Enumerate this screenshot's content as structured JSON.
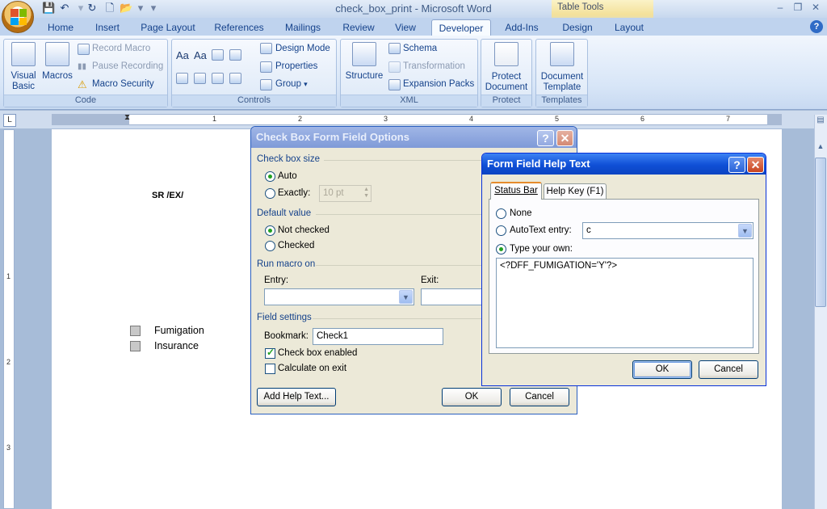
{
  "window": {
    "title": "check_box_print - Microsoft Word",
    "context_tab_group": "Table Tools"
  },
  "ribbon_tabs": [
    {
      "label": "Home"
    },
    {
      "label": "Insert"
    },
    {
      "label": "Page Layout"
    },
    {
      "label": "References"
    },
    {
      "label": "Mailings"
    },
    {
      "label": "Review"
    },
    {
      "label": "View"
    },
    {
      "label": "Developer",
      "active": true
    },
    {
      "label": "Add-Ins"
    },
    {
      "label": "Design"
    },
    {
      "label": "Layout"
    }
  ],
  "ribbon": {
    "code": {
      "label": "Code",
      "visual_basic": "Visual Basic",
      "macros": "Macros",
      "record_macro": "Record Macro",
      "pause_recording": "Pause Recording",
      "macro_security": "Macro Security"
    },
    "controls": {
      "label": "Controls",
      "design_mode": "Design Mode",
      "properties": "Properties",
      "group": "Group"
    },
    "xml": {
      "label": "XML",
      "structure": "Structure",
      "schema": "Schema",
      "transformation": "Transformation",
      "expansion_packs": "Expansion Packs"
    },
    "protect": {
      "label": "Protect",
      "protect_document_l1": "Protect",
      "protect_document_l2": "Document"
    },
    "templates": {
      "label": "Templates",
      "document_template_l1": "Document",
      "document_template_l2": "Template"
    }
  },
  "ruler": {
    "numbers": [
      "1",
      "2",
      "3",
      "4",
      "5",
      "6",
      "7"
    ],
    "vertical_numbers": [
      "1",
      "2",
      "3"
    ]
  },
  "document": {
    "code_text": "SR /EX/",
    "checkbox_items": [
      "Fumigation",
      "Insurance"
    ]
  },
  "checkbox_dialog": {
    "title": "Check Box Form Field Options",
    "size_section": "Check box size",
    "auto": "Auto",
    "exactly": "Exactly:",
    "exactly_value": "10 pt",
    "default_section": "Default value",
    "not_checked": "Not checked",
    "checked": "Checked",
    "macro_section": "Run macro on",
    "entry": "Entry:",
    "exit": "Exit:",
    "field_section": "Field settings",
    "bookmark_label": "Bookmark:",
    "bookmark_value": "Check1",
    "enabled_label": "Check box enabled",
    "calc_label": "Calculate on exit",
    "add_help": "Add Help Text...",
    "ok": "OK",
    "cancel": "Cancel"
  },
  "help_dialog": {
    "title": "Form Field Help Text",
    "tab_status": "Status Bar",
    "tab_helpkey": "Help Key (F1)",
    "none": "None",
    "autotext": "AutoText entry:",
    "autotext_value": "c",
    "type_own": "Type your own:",
    "text_value": "<?DFF_FUMIGATION='Y'?>",
    "ok": "OK",
    "cancel": "Cancel"
  }
}
